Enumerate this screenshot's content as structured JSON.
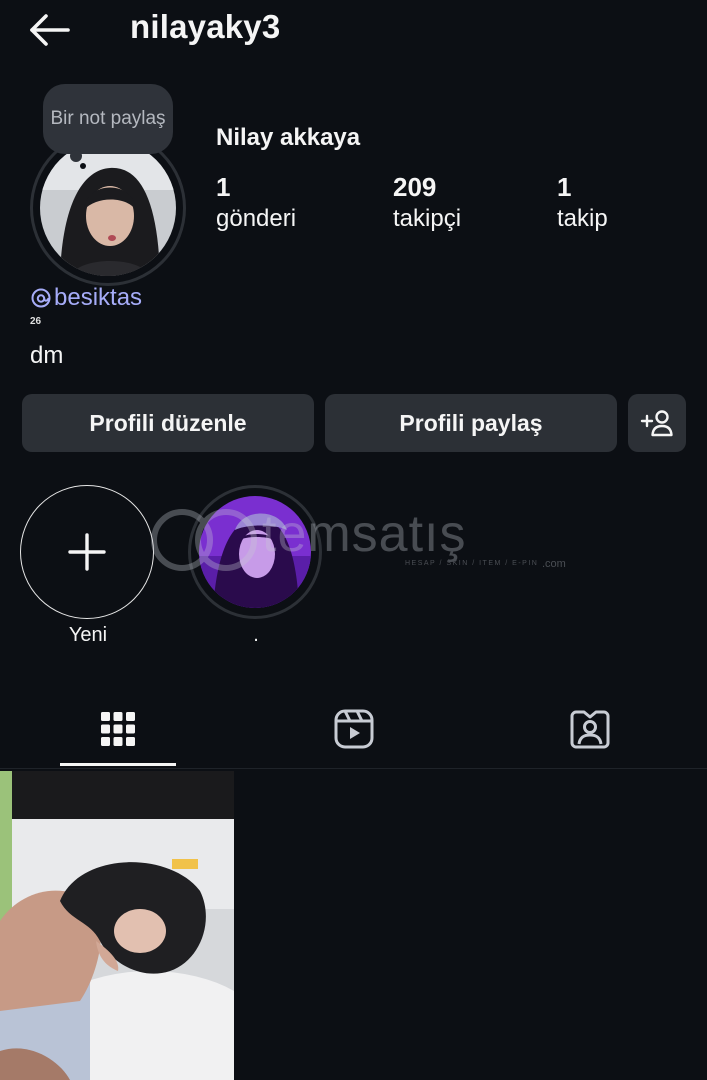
{
  "header": {
    "username": "nilayaky3"
  },
  "profile": {
    "note": "Bir not paylaş",
    "full_name": "Nilay akkaya",
    "stats": [
      {
        "value": "1",
        "label": "gönderi"
      },
      {
        "value": "209",
        "label": "takipçi"
      },
      {
        "value": "1",
        "label": "takip"
      }
    ],
    "threads_handle": "besiktas",
    "threads_count": "26",
    "bio": "dm"
  },
  "actions": {
    "edit_profile": "Profili düzenle",
    "share_profile": "Profili paylaş"
  },
  "highlights": [
    {
      "label": "Yeni"
    },
    {
      "label": "."
    }
  ],
  "watermark": {
    "text": "temsatış",
    "sub": "HESAP / SKIN / ITEM / E-PIN",
    "suffix": ".com"
  },
  "icons": {
    "back": "arrow-left-icon",
    "threads": "threads-icon",
    "add_person": "add-person-icon",
    "plus": "plus-icon",
    "grid": "grid-icon",
    "reels": "reels-icon",
    "tagged": "tagged-icon"
  },
  "colors": {
    "background": "#0c0f14",
    "button": "#2c3036",
    "link": "#a6acf8"
  }
}
